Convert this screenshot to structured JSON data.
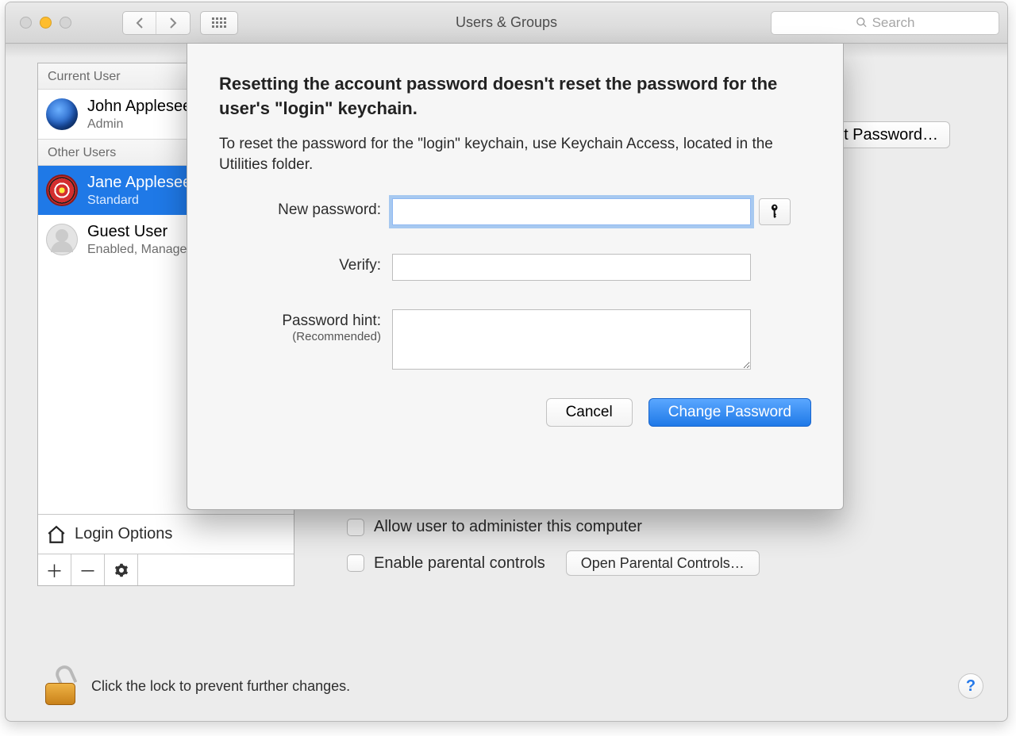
{
  "window": {
    "title": "Users & Groups",
    "search_placeholder": "Search"
  },
  "sidebar": {
    "current_header": "Current User",
    "other_header": "Other Users",
    "current_user": {
      "name": "John Appleseed",
      "role": "Admin"
    },
    "other_users": [
      {
        "name": "Jane Appleseed",
        "role": "Standard"
      },
      {
        "name": "Guest User",
        "role": "Enabled, Managed"
      }
    ],
    "login_options": "Login Options"
  },
  "right": {
    "reset_password_btn": "Reset Password…",
    "allow_admin": "Allow user to administer this computer",
    "enable_parental": "Enable parental controls",
    "open_parental_btn": "Open Parental Controls…"
  },
  "footer": {
    "lock_text": "Click the lock to prevent further changes."
  },
  "sheet": {
    "heading": "Resetting the account password doesn't reset the password for the user's \"login\" keychain.",
    "description": "To reset the password for the \"login\" keychain, use Keychain Access, located in the Utilities folder.",
    "labels": {
      "new_password": "New password:",
      "verify": "Verify:",
      "hint": "Password hint:",
      "hint_sub": "(Recommended)"
    },
    "values": {
      "new_password": "",
      "verify": "",
      "hint": ""
    },
    "buttons": {
      "cancel": "Cancel",
      "change": "Change Password"
    }
  }
}
